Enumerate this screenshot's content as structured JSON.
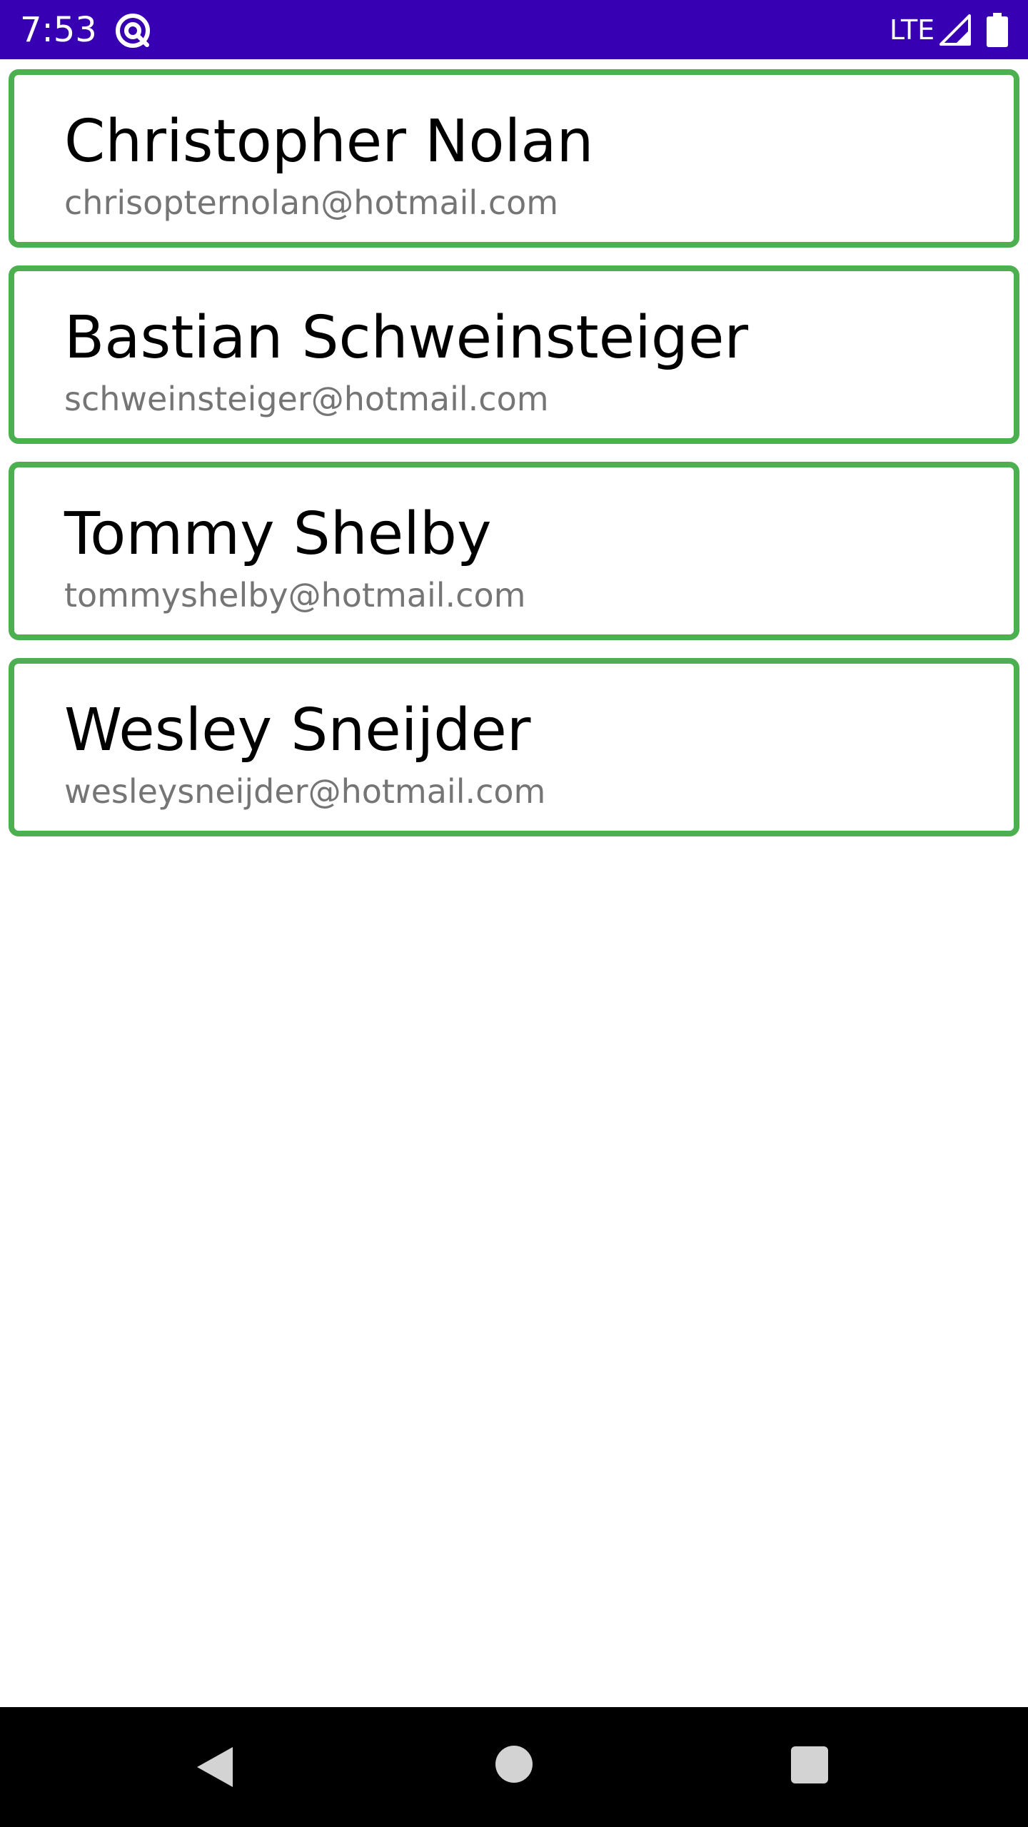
{
  "status_bar": {
    "time": "7:53",
    "network": "LTE",
    "app_icon": "at-sign-icon",
    "signal_icon": "signal-icon",
    "battery_icon": "battery-icon",
    "background_color": "#3700b3"
  },
  "contacts": [
    {
      "name": "Christopher Nolan",
      "email": "chrisopternolan@hotmail.com"
    },
    {
      "name": "Bastian Schweinsteiger",
      "email": "schweinsteiger@hotmail.com"
    },
    {
      "name": "Tommy Shelby",
      "email": "tommyshelby@hotmail.com"
    },
    {
      "name": "Wesley Sneijder",
      "email": "wesleysneijder@hotmail.com"
    }
  ],
  "card_border_color": "#4caf50",
  "nav_bar": {
    "back_icon": "back-triangle-icon",
    "home_icon": "home-circle-icon",
    "recents_icon": "recents-square-icon"
  }
}
